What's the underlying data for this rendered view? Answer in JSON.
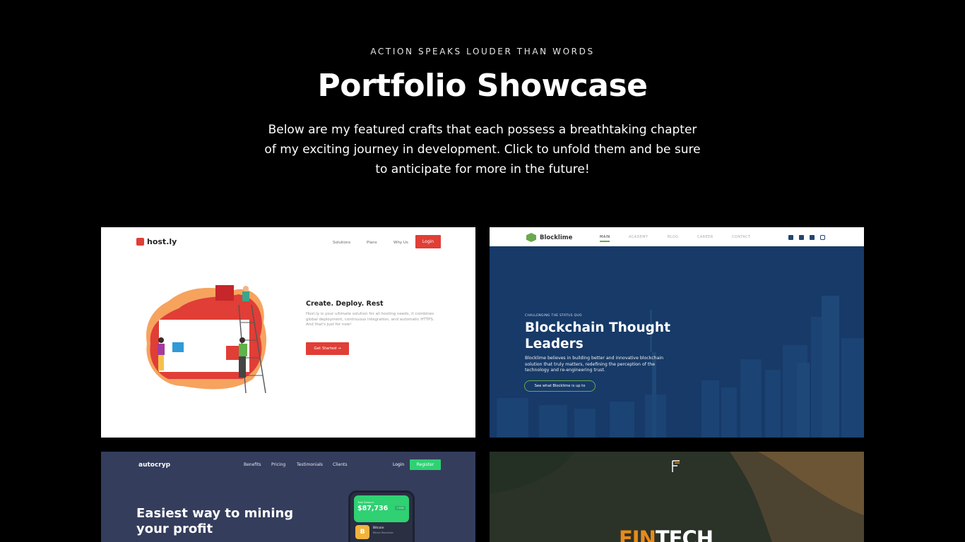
{
  "header": {
    "eyebrow": "ACTION SPEAKS LOUDER THAN WORDS",
    "title": "Portfolio Showcase",
    "lead": "Below are my featured crafts that each possess a breathtaking chapter of my exciting journey in development. Click to unfold them and be sure to anticipate for more in the future!"
  },
  "projects": [
    {
      "name": "host.ly",
      "nav": [
        "Solutions",
        "Plans",
        "Why Us"
      ],
      "login": "Login",
      "heading": "Create. Deploy. Rest",
      "text": "Host.ly is your ultimate solution for all hosting needs, it combines global deployment, continuous integration, and automatic HTTPS. And that's just for now!",
      "cta": "Get Started →",
      "accent": "#e03e36"
    },
    {
      "name": "Blocklime",
      "nav": [
        "MAIN",
        "ACADEMY",
        "BLOG",
        "CAREER",
        "CONTACT"
      ],
      "social": [
        "facebook-icon",
        "linkedin-icon",
        "twitter-icon",
        "instagram-icon"
      ],
      "eyebrow": "CHALLENGING THE STATUS QUO",
      "heading": "Blockchain Thought Leaders",
      "text": "Blocklime believes in building better and innovative blockchain solution that truly matters, redefining the perception of the technology and re-engineering trust.",
      "cta": "See what Blocklime is up to",
      "accent": "#6aa84f"
    },
    {
      "name": "autocryp",
      "nav": [
        "Benefits",
        "Pricing",
        "Testimonials",
        "Clients"
      ],
      "login": "Login",
      "register": "Register",
      "heading": "Easiest way to mining your profit",
      "phone": {
        "balance_label": "Total Balance",
        "balance": "$87,736",
        "badge": "+12%",
        "coin_symbol": "B",
        "coin_name": "Bitcoin",
        "coin_sub": "Bitcoin Blockchain"
      },
      "accent": "#2fd173"
    },
    {
      "name": "FINTECH",
      "title_accent": "FIN",
      "title_rest": "TECH",
      "accent": "#e88a1c"
    }
  ]
}
